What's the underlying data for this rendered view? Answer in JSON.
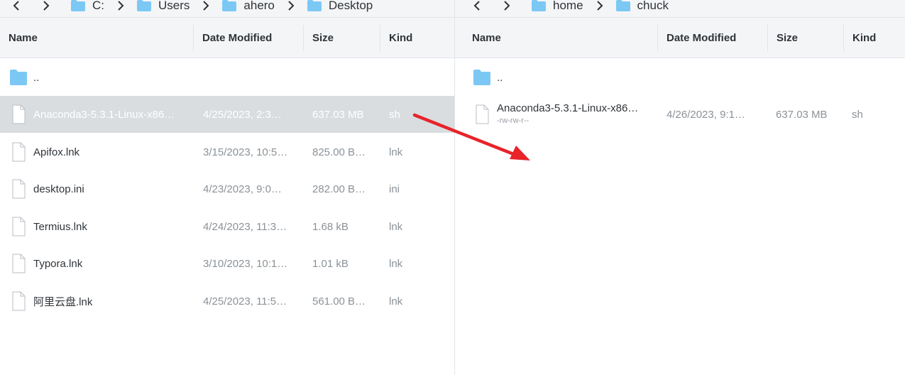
{
  "left_pane": {
    "breadcrumb": [
      "C:",
      "Users",
      "ahero",
      "Desktop"
    ],
    "columns": [
      "Name",
      "Date Modified",
      "Size",
      "Kind"
    ],
    "parent_label": "..",
    "files": [
      {
        "name": "Anaconda3-5.3.1-Linux-x86…",
        "date": "4/25/2023, 2:3…",
        "size": "637.03 MB",
        "kind": "sh"
      },
      {
        "name": "Apifox.lnk",
        "date": "3/15/2023, 10:5…",
        "size": "825.00 B…",
        "kind": "lnk"
      },
      {
        "name": "desktop.ini",
        "date": "4/23/2023, 9:0…",
        "size": "282.00 B…",
        "kind": "ini"
      },
      {
        "name": "Termius.lnk",
        "date": "4/24/2023, 11:3…",
        "size": "1.68 kB",
        "kind": "lnk"
      },
      {
        "name": "Typora.lnk",
        "date": "3/10/2023, 10:1…",
        "size": "1.01 kB",
        "kind": "lnk"
      },
      {
        "name": "阿里云盘.lnk",
        "date": "4/25/2023, 11:5…",
        "size": "561.00 B…",
        "kind": "lnk"
      }
    ]
  },
  "right_pane": {
    "breadcrumb": [
      "home",
      "chuck"
    ],
    "columns": [
      "Name",
      "Date Modified",
      "Size",
      "Kind"
    ],
    "parent_label": "..",
    "files": [
      {
        "name": "Anaconda3-5.3.1-Linux-x86…",
        "permissions": "-rw-rw-r--",
        "date": "4/26/2023, 9:1…",
        "size": "637.03 MB",
        "kind": "sh"
      }
    ]
  },
  "colors": {
    "folder": "#7cc8f5",
    "selection": "#d9dde0",
    "arrow": "#e8232a"
  },
  "icons": [
    "back-icon",
    "forward-icon",
    "folder-icon",
    "file-icon",
    "chevron-right-icon"
  ]
}
